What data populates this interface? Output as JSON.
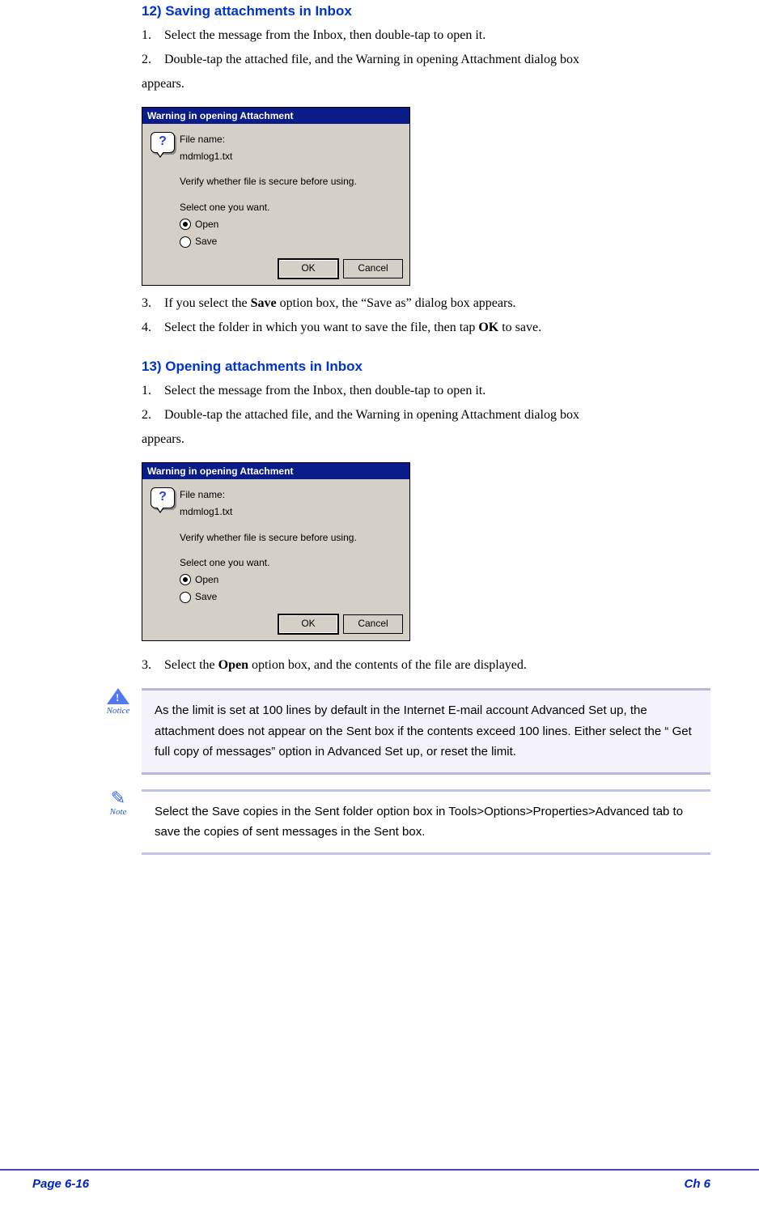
{
  "section12": {
    "heading": "12) Saving attachments in Inbox",
    "step1": "Select the message from the Inbox, then double-tap to open it.",
    "step2": "Double-tap the attached file, and the Warning in opening Attachment dialog box appears.",
    "step3_pre": "If you select the ",
    "step3_bold": "Save",
    "step3_post": " option box, the “Save as” dialog box appears.",
    "step4_pre": "Select the folder in which you want to save the file, then tap ",
    "step4_bold": "OK",
    "step4_post": " to save."
  },
  "section13": {
    "heading": "13) Opening attachments in Inbox",
    "step1": "Select the message from the Inbox, then double-tap to open it.",
    "step2": "Double-tap the attached file, and the Warning in opening Attachment dialog box appears.",
    "step3_pre": "Select the ",
    "step3_bold": "Open",
    "step3_post": " option box, and the contents of the file are displayed."
  },
  "dialog": {
    "title": "Warning in opening Attachment",
    "filename_label": "File name:",
    "filename_value": "mdmlog1.txt",
    "verify": "Verify whether file is secure before using.",
    "select": "Select one you want.",
    "open": "Open",
    "save": "Save",
    "ok": "OK",
    "cancel": "Cancel",
    "icon": "?"
  },
  "notice": {
    "label": "Notice",
    "text": "As the limit is set at 100 lines by default in the Internet E-mail account Advanced Set up, the attachment does not appear on the Sent box if the contents exceed 100 lines. Either select the “ Get full copy of messages” option in Advanced Set up, or reset the limit."
  },
  "note": {
    "label": "Note",
    "text": "Select the Save copies in the Sent folder option box in Tools>Options>Properties>Advanced tab to save the copies of sent messages in the Sent box."
  },
  "footer": {
    "page": "Page 6-16",
    "chapter": "Ch 6"
  },
  "nums": {
    "n1": "1.",
    "n2": "2.",
    "n3": "3.",
    "n4": "4."
  }
}
